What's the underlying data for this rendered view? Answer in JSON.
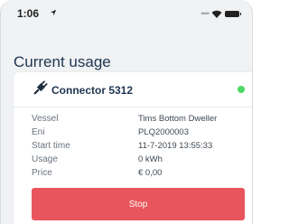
{
  "status_bar": {
    "time": "1:06",
    "location_icon": "location-arrow-icon",
    "signal_icon": "signal-dots-icon",
    "wifi_icon": "wifi-icon",
    "battery_icon": "battery-icon"
  },
  "page": {
    "title": "Current usage"
  },
  "connector": {
    "icon": "plug-icon",
    "name": "Connector 5312",
    "status_color": "#4cd964"
  },
  "details": {
    "vessel": {
      "label": "Vessel",
      "value": "Tims Bottom Dweller"
    },
    "eni": {
      "label": "Eni",
      "value": "PLQ2000003"
    },
    "start_time": {
      "label": "Start time",
      "value": "11-7-2019 13:55:33"
    },
    "usage": {
      "label": "Usage",
      "value": "0 kWh"
    },
    "price": {
      "label": "Price",
      "value": "€ 0,00"
    }
  },
  "actions": {
    "stop_label": "Stop",
    "stop_color": "#e8555c"
  }
}
